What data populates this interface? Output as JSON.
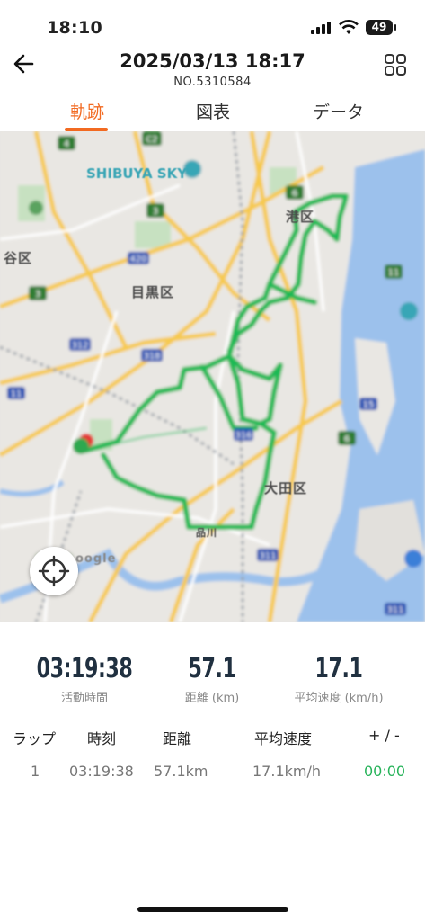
{
  "status": {
    "time": "18:10",
    "battery": "49"
  },
  "header": {
    "title": "2025/03/13 18:17",
    "subtitle": "NO.5310584"
  },
  "tabs": [
    "軌跡",
    "図表",
    "データ"
  ],
  "map": {
    "labels": {
      "shibuya_sky": "SHIBUYA SKY",
      "minato": "港区",
      "meguro": "目黒区",
      "setagaya_partial": "谷区",
      "ota": "大田区",
      "shinagawa": "品川",
      "google": "oogle"
    },
    "route_color": "#1db954"
  },
  "stats": [
    {
      "value": "03:19:38",
      "label": "活動時間"
    },
    {
      "value": "57.1",
      "label": "距離 (km)"
    },
    {
      "value": "17.1",
      "label": "平均速度 (km/h)"
    }
  ],
  "laps": {
    "headers": [
      "ラップ",
      "時刻",
      "距離",
      "平均速度",
      "+ / -"
    ],
    "rows": [
      [
        "1",
        "03:19:38",
        "57.1km",
        "17.1km/h",
        "00:00"
      ]
    ]
  },
  "colors": {
    "accent": "#f26a21",
    "positive": "#27b35a"
  }
}
